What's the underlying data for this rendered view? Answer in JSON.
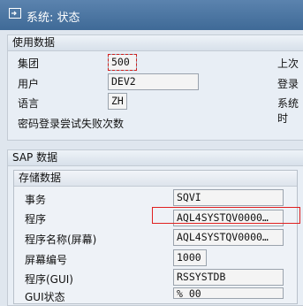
{
  "window": {
    "title": "系统: 状态"
  },
  "usage_section": {
    "header": "使用数据",
    "rows": [
      {
        "label": "集团",
        "value": "500"
      },
      {
        "label": "用户",
        "value": "DEV2"
      },
      {
        "label": "语言",
        "value": "ZH"
      }
    ],
    "failed_logins_label": "密码登录尝试失败次数",
    "right_labels": [
      "上次",
      "登录",
      "系统时"
    ]
  },
  "sap_section": {
    "header": "SAP 数据",
    "sub_header": "存储数据",
    "rows": [
      {
        "label": "事务",
        "value": "SQVI"
      },
      {
        "label": "程序",
        "value": "AQL4SYSTQV0000…"
      },
      {
        "label": "程序名称(屏幕)",
        "value": "AQL4SYSTQV0000…"
      },
      {
        "label": "屏幕编号",
        "value": "1000"
      },
      {
        "label": "程序(GUI)",
        "value": "RSSYSTDB"
      },
      {
        "label": "GUI状态",
        "value": "%_00"
      }
    ]
  },
  "colors": {
    "titlebar": "#4a739f",
    "highlight": "#e02020"
  },
  "icons": {
    "title": "window-status-icon"
  }
}
